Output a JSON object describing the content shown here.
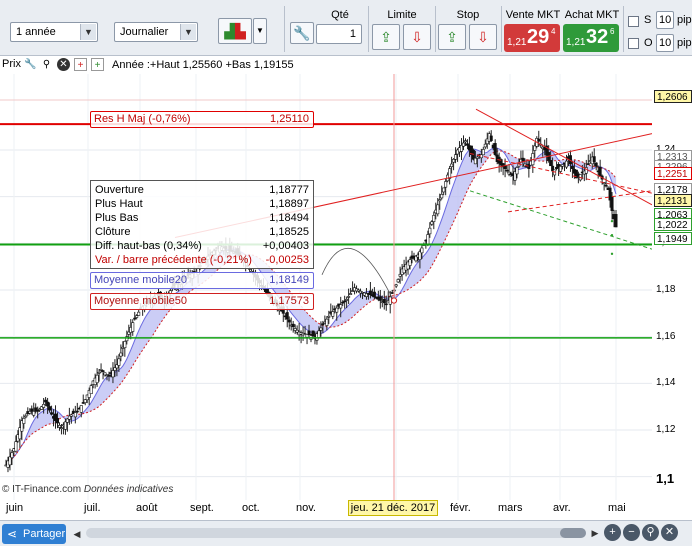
{
  "toolbar": {
    "period": "1 année",
    "timeframe": "Journalier",
    "qty_label": "Qté",
    "qty_value": "1",
    "limit_label": "Limite",
    "stop_label": "Stop",
    "sell_label": "Vente MKT",
    "buy_label": "Achat MKT",
    "sell_quote": {
      "small": "1,21",
      "big": "29",
      "sup": "4"
    },
    "buy_quote": {
      "small": "1,21",
      "big": "32",
      "sup": "6"
    },
    "option_s": "S",
    "option_o": "O",
    "pips_value_1": "10",
    "pips_value_2": "10",
    "pips_label": "pip"
  },
  "infobar": {
    "label": "Prix",
    "summary": "Année :+Haut 1,25560 +Bas 1,19155"
  },
  "overlays": {
    "resistance": {
      "label": "Res H Maj (-0,76%)",
      "value": "1,25110"
    },
    "ma20": {
      "label": "Moyenne mobile20",
      "value": "1,18149"
    },
    "ma50": {
      "label": "Moyenne mobile50",
      "value": "1,17573"
    },
    "ohlc": [
      {
        "k": "Ouverture",
        "v": "1,18777"
      },
      {
        "k": "Plus Haut",
        "v": "1,18897"
      },
      {
        "k": "Plus Bas",
        "v": "1,18494"
      },
      {
        "k": "Clôture",
        "v": "1,18525"
      },
      {
        "k": "Diff. haut-bas (0,34%)",
        "v": "+0,00403"
      },
      {
        "k": "Var. / barre précédente (-0,21%)",
        "v": "-0,00253"
      }
    ]
  },
  "price_axis": {
    "labels": [
      "1,24",
      "1,22",
      "1,2",
      "1,18",
      "1,16",
      "1,14",
      "1,12",
      "1,1"
    ],
    "tags": [
      {
        "text": "1,2606",
        "bg": "#fff7a8"
      },
      {
        "text": "1,2313",
        "bg": "#ffffff"
      },
      {
        "text": "1,2296",
        "bg": "#ffffff"
      },
      {
        "text": "1,2251",
        "bg": "#ffffff"
      },
      {
        "text": "1,2178",
        "bg": "#ffffff"
      },
      {
        "text": "1,2131",
        "bg": "#fff7a8"
      },
      {
        "text": "1,2063",
        "bg": "#ffffff"
      },
      {
        "text": "1,2022",
        "bg": "#ffffff"
      },
      {
        "text": "1,1949",
        "bg": "#ffffff"
      }
    ]
  },
  "time_axis": {
    "labels": [
      "juin",
      "juil.",
      "août",
      "sept.",
      "oct.",
      "nov.",
      "déc.",
      "févr.",
      "mars",
      "avr.",
      "mai"
    ],
    "cursor_date": "jeu. 21 déc. 2017"
  },
  "watermark": {
    "source": "© IT-Finance.com",
    "note": "Données indicatives"
  },
  "bottombar": {
    "share_label": "Partager"
  },
  "colors": {
    "sell": "#d23a3a",
    "buy": "#2f9a3a",
    "resistance": "#e00000",
    "support": "#11a011",
    "ma20": "#6a6ae0",
    "ma50": "#d02020"
  },
  "chart_data": {
    "type": "candlestick",
    "instrument_hint": "EUR/USD daily",
    "ylim": [
      1.09,
      1.27
    ],
    "horizontal_lines": [
      {
        "name": "Res H Maj",
        "value": 1.2511
      },
      {
        "name": "support",
        "value": 1.1995
      },
      {
        "name": "support",
        "value": 1.1595
      }
    ],
    "series": [
      {
        "name": "Moyenne mobile20",
        "last": 1.18149
      },
      {
        "name": "Moyenne mobile50",
        "last": 1.17573
      }
    ],
    "close_path": [
      [
        0,
        1.105
      ],
      [
        8,
        1.112
      ],
      [
        16,
        1.124
      ],
      [
        24,
        1.128
      ],
      [
        32,
        1.128
      ],
      [
        40,
        1.132
      ],
      [
        48,
        1.125
      ],
      [
        56,
        1.121
      ],
      [
        64,
        1.126
      ],
      [
        72,
        1.128
      ],
      [
        80,
        1.133
      ],
      [
        88,
        1.141
      ],
      [
        96,
        1.146
      ],
      [
        104,
        1.143
      ],
      [
        112,
        1.148
      ],
      [
        120,
        1.158
      ],
      [
        128,
        1.166
      ],
      [
        136,
        1.172
      ],
      [
        144,
        1.175
      ],
      [
        152,
        1.178
      ],
      [
        160,
        1.176
      ],
      [
        168,
        1.181
      ],
      [
        176,
        1.184
      ],
      [
        184,
        1.186
      ],
      [
        192,
        1.188
      ],
      [
        200,
        1.193
      ],
      [
        208,
        1.196
      ],
      [
        216,
        1.199
      ],
      [
        224,
        1.197
      ],
      [
        232,
        1.196
      ],
      [
        240,
        1.193
      ],
      [
        248,
        1.188
      ],
      [
        256,
        1.183
      ],
      [
        264,
        1.178
      ],
      [
        272,
        1.174
      ],
      [
        280,
        1.17
      ],
      [
        288,
        1.165
      ],
      [
        296,
        1.162
      ],
      [
        304,
        1.161
      ],
      [
        312,
        1.16
      ],
      [
        320,
        1.165
      ],
      [
        328,
        1.17
      ],
      [
        336,
        1.173
      ],
      [
        344,
        1.176
      ],
      [
        352,
        1.181
      ],
      [
        360,
        1.179
      ],
      [
        368,
        1.178
      ],
      [
        376,
        1.176
      ],
      [
        384,
        1.174
      ],
      [
        392,
        1.18
      ],
      [
        400,
        1.189
      ],
      [
        408,
        1.193
      ],
      [
        416,
        1.195
      ],
      [
        424,
        1.201
      ],
      [
        432,
        1.212
      ],
      [
        440,
        1.221
      ],
      [
        448,
        1.232
      ],
      [
        456,
        1.24
      ],
      [
        464,
        1.244
      ],
      [
        472,
        1.236
      ],
      [
        480,
        1.238
      ],
      [
        488,
        1.247
      ],
      [
        496,
        1.235
      ],
      [
        504,
        1.232
      ],
      [
        512,
        1.229
      ],
      [
        520,
        1.236
      ],
      [
        528,
        1.232
      ],
      [
        536,
        1.245
      ],
      [
        544,
        1.24
      ],
      [
        552,
        1.231
      ],
      [
        560,
        1.233
      ],
      [
        568,
        1.236
      ],
      [
        576,
        1.228
      ],
      [
        584,
        1.231
      ],
      [
        592,
        1.237
      ],
      [
        600,
        1.229
      ],
      [
        608,
        1.223
      ],
      [
        612,
        1.214
      ],
      [
        616,
        1.207
      ]
    ]
  }
}
